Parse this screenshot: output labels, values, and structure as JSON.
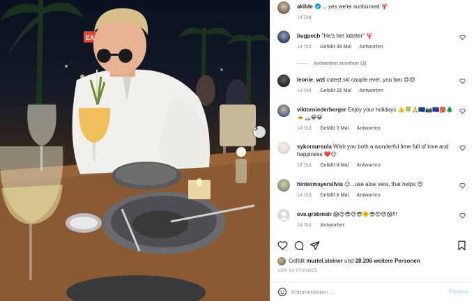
{
  "photo": {
    "sign_text": "EX",
    "next_icon": "chevron-right-icon"
  },
  "post": {
    "author": "akilde",
    "verified": true,
    "caption": "... yes we're sunburned 🦞",
    "time": "14 Std."
  },
  "comments": [
    {
      "user": "bugpech",
      "text": "\"He's her lobster\" 🦞",
      "time": "14 Std.",
      "likes": "Gefällt 38 Mal",
      "reply": "Antworten",
      "avatar_color": "#3b4a6b"
    },
    {
      "user": "leonie_wzl",
      "text": "cutest ski couple ever, you two 😍😍",
      "time": "14 Std.",
      "likes": "Gefällt 22 Mal",
      "reply": "Antworten",
      "avatar_color": "#2b2b2b"
    },
    {
      "user": "viktorniederberger",
      "text": "Enjoy your holidays 👍🍀🙏🇪🇺📷🇪🇺🎒🌲🍝🏔️😁😀",
      "time": "14 Std.",
      "likes": "Gefällt 3 Mal",
      "reply": "Antworten",
      "avatar_color": "#5a6f8a"
    },
    {
      "user": "sykoraursula",
      "text": "Wish you both a wonderful time full of love and happiness ❤️😊",
      "time": "14 Std.",
      "likes": "Gefällt 8 Mal",
      "reply": "Antworten",
      "avatar_color": "#e8e2da"
    },
    {
      "user": "hintermayersilvia",
      "text": "😉...use aloe vera, that helps 😍",
      "time": "14 Std.",
      "likes": "Gefällt 6 Mal",
      "reply": "Antworten",
      "avatar_color": "#9aa088"
    },
    {
      "user": "eva.grabmair",
      "text": "😱😍😎😍😎🌞😎😍😍😱!!!",
      "time": "14 Std.",
      "likes": "",
      "reply": "Antworten",
      "avatar_color": "#dbdbdb"
    }
  ],
  "view_replies": "Antworten ansehen (2)",
  "likes_line": {
    "prefix": "Gefällt ",
    "user": "muriel.steiner",
    "middle": " und ",
    "count": "28.206",
    "suffix": " weitere Personen"
  },
  "post_timestamp": "VOR 14 STUNDEN",
  "add_comment": {
    "placeholder": "Kommentieren ...",
    "post_label": "Posten"
  },
  "colors": {
    "text": "#262626",
    "muted": "#8e8e8e",
    "verified": "#0095f6",
    "post_disabled": "#b3dbff",
    "divider": "#efefef"
  },
  "icons": {
    "like": "heart-icon",
    "comment": "comment-icon",
    "share": "share-icon",
    "save": "bookmark-icon",
    "emoji": "smile-icon"
  }
}
